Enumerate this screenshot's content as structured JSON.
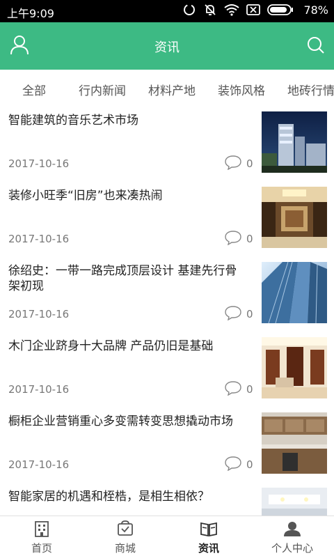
{
  "status_bar": {
    "time": "上午9:09",
    "battery_pct": "78%",
    "icons": [
      "sync-icon",
      "mute-icon",
      "wifi-icon",
      "sim-off-icon",
      "battery-icon"
    ]
  },
  "header": {
    "title": "资讯",
    "left_icon": "user-icon",
    "right_icon": "search-icon",
    "background": "#3dba84"
  },
  "tabs": [
    {
      "label": "全部"
    },
    {
      "label": "行内新闻"
    },
    {
      "label": "材料产地"
    },
    {
      "label": "装饰风格"
    },
    {
      "label": "地砖行情"
    }
  ],
  "articles": [
    {
      "title": "智能建筑的音乐艺术市场",
      "date": "2017-10-16",
      "comments": "0",
      "thumb": "building-night-image"
    },
    {
      "title": "装修小旺季“旧房”也来凑热闹",
      "date": "2017-10-16",
      "comments": "0",
      "thumb": "living-room-image"
    },
    {
      "title": "徐绍史：一带一路完成顶层设计 基建先行骨架初现",
      "date": "2017-10-16",
      "comments": "0",
      "thumb": "skyscraper-image"
    },
    {
      "title": "木门企业跻身十大品牌 产品仍旧是基础",
      "date": "2017-10-16",
      "comments": "0",
      "thumb": "door-interior-image"
    },
    {
      "title": "橱柜企业营销重心多变需转变思想撬动市场",
      "date": "2017-10-16",
      "comments": "0",
      "thumb": "kitchen-image"
    },
    {
      "title": "智能家居的机遇和桎梏，是相生相依？",
      "date": "",
      "comments": "",
      "thumb": "ceiling-lights-image"
    }
  ],
  "bottom_nav": [
    {
      "label": "首页",
      "icon": "home-icon"
    },
    {
      "label": "商城",
      "icon": "shop-icon"
    },
    {
      "label": "资讯",
      "icon": "news-icon",
      "active": true
    },
    {
      "label": "个人中心",
      "icon": "profile-icon"
    }
  ],
  "colors": {
    "accent": "#3dba84"
  }
}
